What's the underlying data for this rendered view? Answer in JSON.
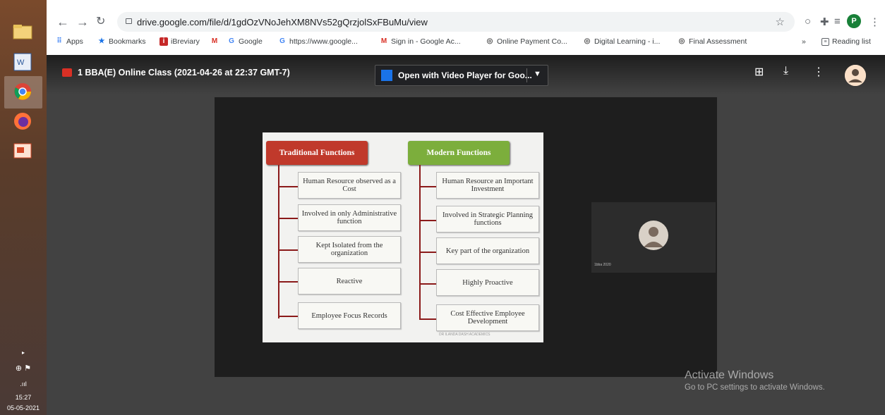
{
  "taskbar": {
    "time": "15:27",
    "date": "05-05-2021",
    "signal": ".ııl"
  },
  "browser": {
    "url": "drive.google.com/file/d/1gdOzVNoJehXM8NVs52gQrzjolSxFBuMu/view",
    "profile_initial": "P",
    "bookmarks": [
      {
        "label": "Apps"
      },
      {
        "label": "Bookmarks"
      },
      {
        "label": "iBreviary"
      },
      {
        "label": ""
      },
      {
        "label": "Google"
      },
      {
        "label": "https://www.google..."
      },
      {
        "label": "Sign in - Google Ac..."
      },
      {
        "label": "Online Payment Co..."
      },
      {
        "label": "Digital Learning - i..."
      },
      {
        "label": "Final Assessment"
      }
    ],
    "overflow": "»",
    "reading_list": "Reading list"
  },
  "viewer": {
    "file_title": "1 BBA(E) Online Class (2021-04-26 at 22:37 GMT-7)",
    "open_with": "Open with Video Player for Goo...",
    "side_name": "1bba 2020"
  },
  "slide": {
    "left_header": "Traditional  Functions",
    "right_header": "Modern  Functions",
    "left_items": [
      "Human Resource observed as a Cost",
      "Involved in only Administrative function",
      "Kept Isolated from the organization",
      "Reactive",
      "Employee Focus Records"
    ],
    "right_items": [
      "Human Resource an Important Investment",
      "Involved in Strategic Planning functions",
      "Key part of the organization",
      "Highly Proactive",
      "Cost Effective Employee Development"
    ],
    "footnote": "DR ILANDA  DASH ACADEMICS"
  },
  "watermark": {
    "line1": "Activate Windows",
    "line2": "Go to PC settings to activate Windows."
  },
  "colors": {
    "traditional_header": "#c0392b",
    "modern_header": "#7cae3c",
    "connector": "#8b1a1a"
  }
}
